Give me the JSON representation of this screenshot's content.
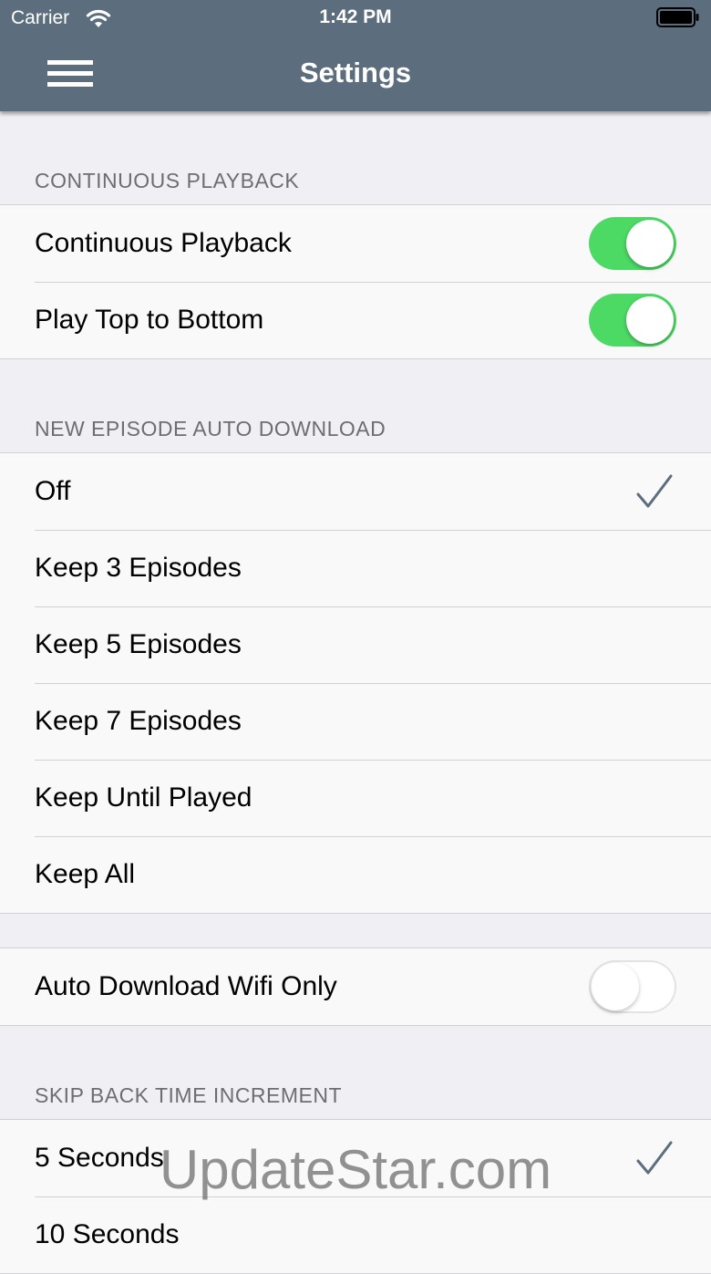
{
  "status_bar": {
    "carrier": "Carrier",
    "time": "1:42 PM"
  },
  "header": {
    "title": "Settings"
  },
  "colors": {
    "header_bg": "#5c6e7e",
    "toggle_on": "#4cd964",
    "checkmark": "#5c6e7e"
  },
  "sections": {
    "continuous": {
      "title": "CONTINUOUS PLAYBACK",
      "rows": [
        {
          "label": "Continuous Playback",
          "toggle": true
        },
        {
          "label": "Play Top to Bottom",
          "toggle": true
        }
      ]
    },
    "auto_download": {
      "title": "NEW EPISODE AUTO DOWNLOAD",
      "selected": "Off",
      "options": [
        "Off",
        "Keep 3 Episodes",
        "Keep 5 Episodes",
        "Keep 7 Episodes",
        "Keep Until Played",
        "Keep All"
      ]
    },
    "wifi": {
      "label": "Auto Download Wifi Only",
      "toggle": false
    },
    "skip_back": {
      "title": "SKIP BACK TIME INCREMENT",
      "selected": "5 Seconds",
      "options": [
        "5 Seconds",
        "10 Seconds"
      ]
    }
  },
  "watermark": "UpdateStar.com"
}
